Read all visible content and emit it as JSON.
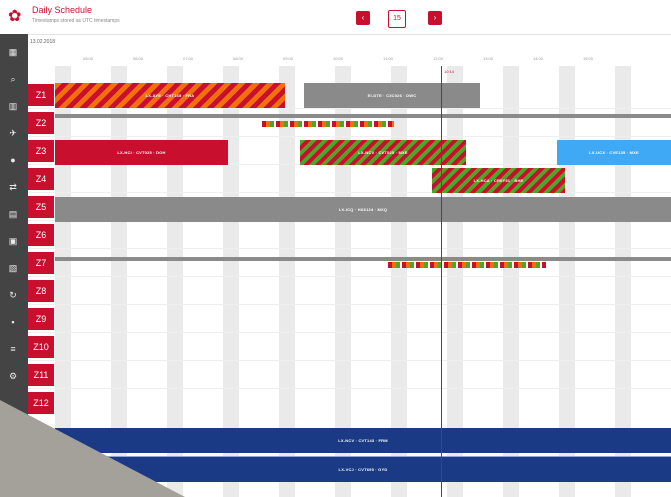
{
  "app": {
    "title": "Daily Schedule",
    "subtitle": "Timestamps stored as UTC timestamps",
    "date": "13.02.2018"
  },
  "nav": {
    "prev_icon": "chevron-left-icon",
    "prev_glyph": "‹",
    "next_icon": "chevron-right-icon",
    "next_glyph": "›",
    "calendar_icon": "calendar-icon",
    "calendar_glyph": "15"
  },
  "colors": {
    "accent": "#c8102e",
    "sidebar": "#444444",
    "grey_bar": "#8a8a8a",
    "blue_bar": "#3fa9f5",
    "navy_bar": "#1b3a86",
    "stripe_orange": "#f26f0a",
    "stripe_green": "#4da629"
  },
  "sidebar_icons": [
    "grid-icon",
    "search-icon",
    "building-icon",
    "plane-icon",
    "location-icon",
    "transfer-icon",
    "document-icon",
    "clipboard-icon",
    "notes-icon",
    "refresh-icon",
    "archive-icon",
    "list-icon",
    "settings-icon"
  ],
  "timeline": {
    "hours": [
      "05:00",
      "06:00",
      "07:00",
      "08:00",
      "09:00",
      "10:00",
      "11:00",
      "12:00",
      "13:00",
      "14:00",
      "15:00"
    ],
    "now_label": "10:14"
  },
  "rows": [
    "Z1",
    "Z2",
    "Z3",
    "Z4",
    "Z5",
    "Z6",
    "Z7",
    "Z8",
    "Z9",
    "Z10",
    "Z11",
    "Z12"
  ],
  "bookings": [
    {
      "label": "LX-AYE · CHT145 · FRA"
    },
    {
      "label": "EI-DTE · C3C026 · DWC"
    },
    {
      "label": "LX-NYZ · CTYCE1 · FRA"
    },
    {
      "label": "LX-HCI · CVT025 · DOH"
    },
    {
      "label": "LX-NCV · CVT025 · MXE"
    },
    {
      "label": "LX-UCX · CVE135 · MXE"
    },
    {
      "label": "LX-HCA · CR6Y51 · BHE"
    },
    {
      "label": "LX-ICQ · HX6124 · MXQ"
    },
    {
      "label": "LX-NCV · CVT143 · FRM"
    },
    {
      "label": "LX-VCJ · CVT695 · GYD"
    }
  ]
}
